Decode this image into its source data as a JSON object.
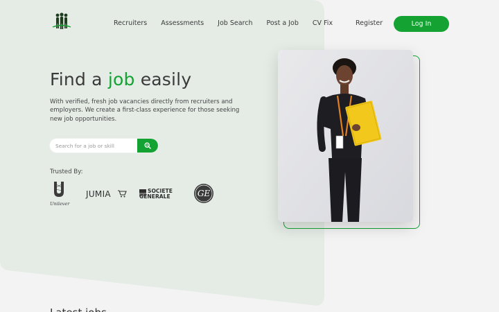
{
  "nav": {
    "items": [
      {
        "label": "Recruiters"
      },
      {
        "label": "Assessments"
      },
      {
        "label": "Job Search"
      },
      {
        "label": "Post a Job"
      },
      {
        "label": "CV Fix"
      }
    ],
    "register_label": "Register",
    "login_label": "Log In"
  },
  "hero": {
    "title_prefix": "Find a ",
    "title_accent": "job",
    "title_suffix": " easily",
    "subtitle": "With verified, fresh job vacancies directly from recruiters and employers. We create a first-class experience for those seeking new job opportunities.",
    "search_placeholder": "Search for a job or skill",
    "trusted_label": "Trusted By:",
    "partners": [
      {
        "name": "Unilever"
      },
      {
        "name": "JUMIA"
      },
      {
        "name": "SOCIETE"
      },
      {
        "name": "GENERALE"
      },
      {
        "name": "GE"
      }
    ]
  },
  "next_section": {
    "title": "Latest jobs"
  },
  "colors": {
    "brand_green": "#14a233",
    "hero_background": "#e5ece6",
    "page_background": "#f3f3f3"
  }
}
